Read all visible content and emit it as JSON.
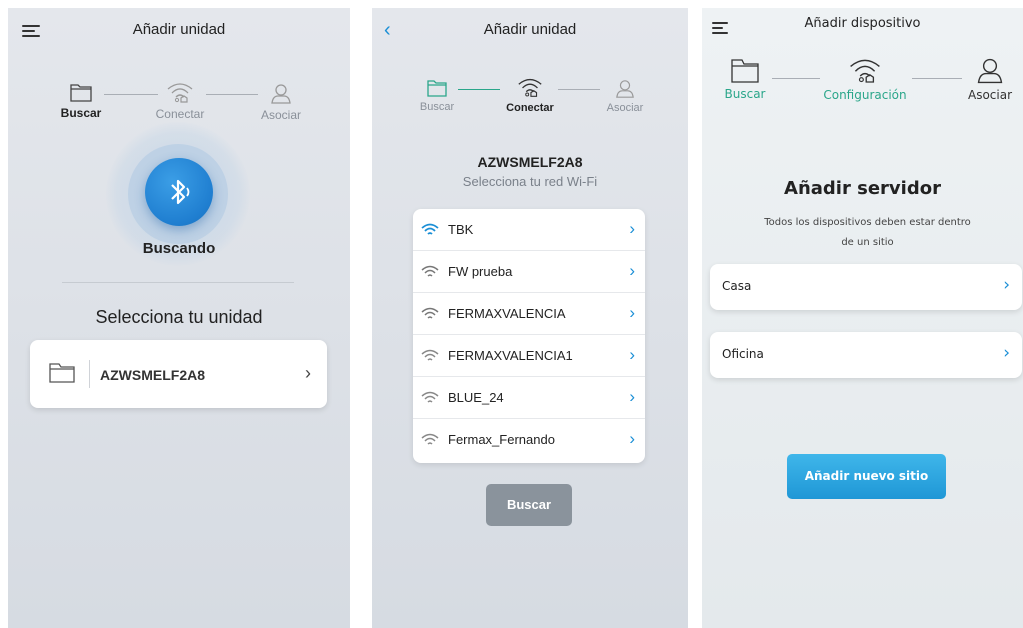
{
  "screen1": {
    "title": "Añadir unidad",
    "steps": [
      "Buscar",
      "Conectar",
      "Asociar"
    ],
    "active_step": "Buscar",
    "status": "Buscando",
    "section_title": "Selecciona tu unidad",
    "device_name": "AZWSMELF2A8"
  },
  "screen2": {
    "title": "Añadir unidad",
    "steps": [
      "Buscar",
      "Conectar",
      "Asociar"
    ],
    "active_step": "Conectar",
    "device_name": "AZWSMELF2A8",
    "subtitle": "Selecciona tu red Wi-Fi",
    "networks": [
      "TBK",
      "FW prueba",
      "FERMAXVALENCIA",
      "FERMAXVALENCIA1",
      "BLUE_24",
      "Fermax_Fernando"
    ],
    "search_button": "Buscar"
  },
  "screen3": {
    "title": "Añadir dispositivo",
    "steps": [
      "Buscar",
      "Configuración",
      "Asociar"
    ],
    "active_steps": [
      "Buscar",
      "Configuración"
    ],
    "server_title": "Añadir servidor",
    "description_line1": "Todos los dispositivos deben estar dentro",
    "description_line2": "de un sitio",
    "sites": [
      "Casa",
      "Oficina"
    ],
    "add_site_button": "Añadir nuevo sitio"
  },
  "colors": {
    "accent_blue": "#1b8fd6",
    "active_green": "#2aa68a",
    "button_grey": "#8a939c"
  }
}
